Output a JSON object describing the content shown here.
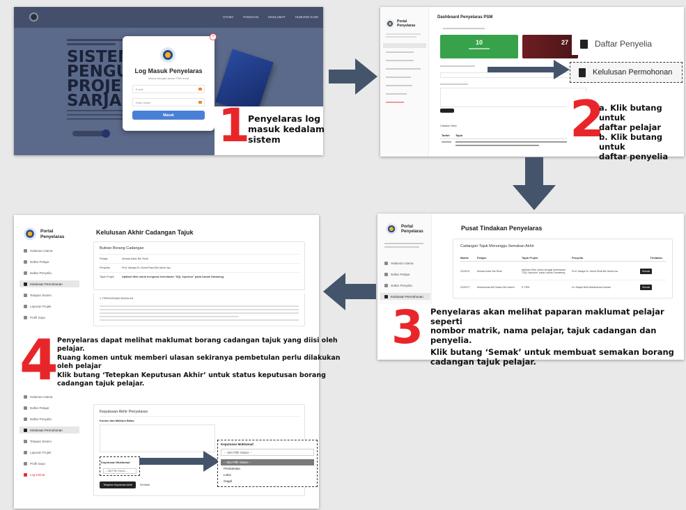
{
  "step1": {
    "number": "1",
    "caption_lines": [
      "Penyelaras log",
      "masuk kedalam",
      "sistem"
    ],
    "hero_lines": [
      "SISTEM",
      "PENGURU",
      "PROJEK",
      "SARJANA"
    ],
    "nav_items": [
      "UTAMA",
      "PANDUAN",
      "MAKLUMAT",
      "HUBUNGI KAMI"
    ],
    "modal": {
      "title": "Log Masuk Penyelaras",
      "subtitle": "Masuk dengan akaun PSM anda",
      "email_placeholder": "E-mel",
      "password_placeholder": "Kata Laluan",
      "submit_label": "Masuk"
    }
  },
  "step2": {
    "number": "2",
    "caption_lines": [
      "a. Klik butang untuk",
      "daftar pelajar",
      "b. Klik butang untuk",
      "daftar penyelia"
    ],
    "dashboard_title": "Dashboard Penyelaras PSM",
    "sidebar_title": "Portal Penyelaras",
    "stat_1": "10",
    "stat_2": "27",
    "zoom_item_1": "Daftar Penyelia",
    "zoom_item_2": "Kelulusan Permohonan",
    "notes_header": "Catatan Nota",
    "table_col_1": "Tarikh",
    "table_col_2": "Tajuk"
  },
  "step3": {
    "number": "3",
    "caption_lines": [
      "Penyelaras akan melihat paparan maklumat pelajar seperti",
      "nombor matrik, nama pelajar, tajuk cadangan dan penyelia.",
      "Klik butang ‘Semak’ untuk membuat semakan borang",
      "cadangan tajuk pelajar."
    ],
    "sidebar_title": "Portal Penyelaras",
    "sidebar_items": [
      "Halaman Utama",
      "Daftar Pelajar",
      "Daftar Penyelia",
      "Kelulusan Permohonan"
    ],
    "page_title": "Pusat Tindakan Penyelaras",
    "card_title": "Cadangan Tajuk Menunggu Semakan Akhir",
    "columns": [
      "Matrik",
      "Pelajar",
      "Tajuk Projek",
      "Penyelia",
      "Tindakan"
    ],
    "rows": [
      {
        "matrik": "2220211",
        "pelajar": "Ahmad Azfar Bin Rusli",
        "tajuk": "Aplikasi Web untuk mengaji kerentanan \"SQL Injection\" pada Laman Daraweng",
        "penyelia": "Prof. Madya Dr. Mohd Rizal Bin Mohd Isa",
        "action": "Semak"
      },
      {
        "matrik": "2220277",
        "pelajar": "Muhammad Arif Nazim Bin Hamzi",
        "tajuk": "E-TRM",
        "penyelia": "Dr. Afiqah Binti Mohammad Kamari",
        "action": "Semak"
      }
    ]
  },
  "step4": {
    "number": "4",
    "caption_lines": [
      "Penyelaras dapat melihat maklumat borang cadangan tajuk yang diisi oleh",
      "pelajar.",
      "Ruang komen untuk memberi ulasan sekiranya pembetulan perlu dilakukan",
      "oleh pelajar",
      "Klik butang ‘Tetepkan Keputusan Akhir’ untuk status keputusan borang",
      "cadangan tajuk pelajar."
    ],
    "sidebar_title": "Portal Penyelaras",
    "sidebar_items": [
      "Halaman Utama",
      "Daftar Pelajar",
      "Daftar Penyelia",
      "Kelulusan Permohonan",
      "Tetapan Sistem",
      "Laporan Projek",
      "Profil Saya",
      "Log Keluar"
    ],
    "page_title": "Kelulusan Akhir Cadangan Tajuk",
    "form_card_title": "Butiran Borang Cadangan",
    "form_rows": [
      {
        "label": "Pelajar",
        "value": "Ahmad Azfar Bin Rusli"
      },
      {
        "label": "Penyelia",
        "value": "Prof. Madya Dr. Mohd Rizal Bin Mohd Isa"
      },
      {
        "label": "Tajuk Projek",
        "value": "Aplikasi Web untuk mengesal kerentanan \"SQL Injection\" pada Laman Daraweng"
      }
    ],
    "section_heading": "1. PERNYATAAN MASALAH",
    "decision_title": "Keputusan Akhir Penyelaras",
    "comment_label": "Komen dan Maklum Balas",
    "decision_label": "Keputusan Muktamad",
    "select_default": "-- Sila Pilih Status --",
    "dropdown_options": [
      "-- Sila Pilih Status --",
      "Pembetulan",
      "Lulus",
      "Gagal"
    ],
    "submit_label": "Tetapkan Keputusan Akhir",
    "back_label": "Kembali"
  },
  "colors": {
    "arrow": "#44546a",
    "step_number": "#e8262a",
    "stat_green": "#37a24a",
    "stat_maroon": "#6e1e22",
    "login_button": "#4a7fd6",
    "hero_overlay": "#3e4d6e"
  }
}
